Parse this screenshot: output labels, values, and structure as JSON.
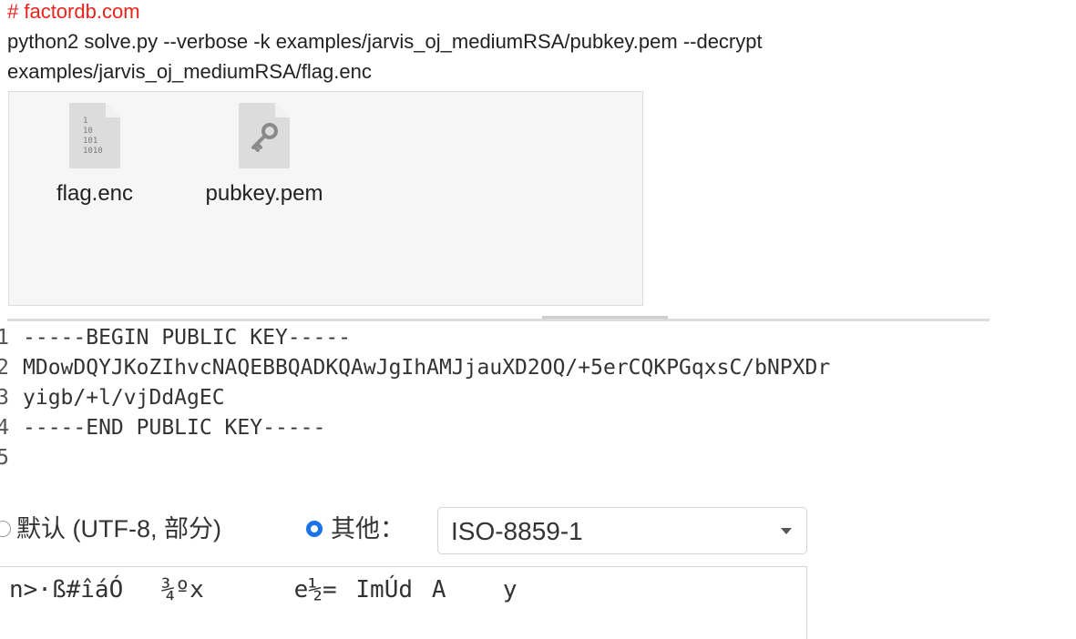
{
  "heading": "# factordb.com",
  "command": {
    "line1": "python2 solve.py --verbose  -k examples/jarvis_oj_mediumRSA/pubkey.pem --decrypt",
    "line2": "examples/jarvis_oj_mediumRSA/flag.enc"
  },
  "files": [
    {
      "name": "flag.enc",
      "icon": "binary-file-icon",
      "icon_text": [
        "1",
        "10",
        "101",
        "1010"
      ]
    },
    {
      "name": "pubkey.pem",
      "icon": "key-file-icon"
    }
  ],
  "editor": {
    "lines": [
      {
        "number": "1",
        "text": "-----BEGIN PUBLIC KEY-----"
      },
      {
        "number": "2",
        "text": "MDowDQYJKoZIhvcNAQEBBQADKQAwJgIhAMJjauXD2OQ/+5erCQKPGqxsC/bNPXDr"
      },
      {
        "number": "3",
        "text": "yigb/+l/vjDdAgEC"
      },
      {
        "number": "4",
        "text": "-----END PUBLIC KEY-----"
      },
      {
        "number": "5",
        "text": ""
      }
    ]
  },
  "encoding": {
    "option_default": "默认 (UTF-8, 部分)",
    "option_other": "其他：",
    "selected_option": "other",
    "selected_encoding": "ISO-8859-1"
  },
  "output": {
    "text": "n>·ß#îáÓ\u0010¾ºx \u000ee½=\bImÚdA\u0011\fy"
  },
  "colors": {
    "heading": "#e8231c",
    "accent": "#1a73e8"
  }
}
